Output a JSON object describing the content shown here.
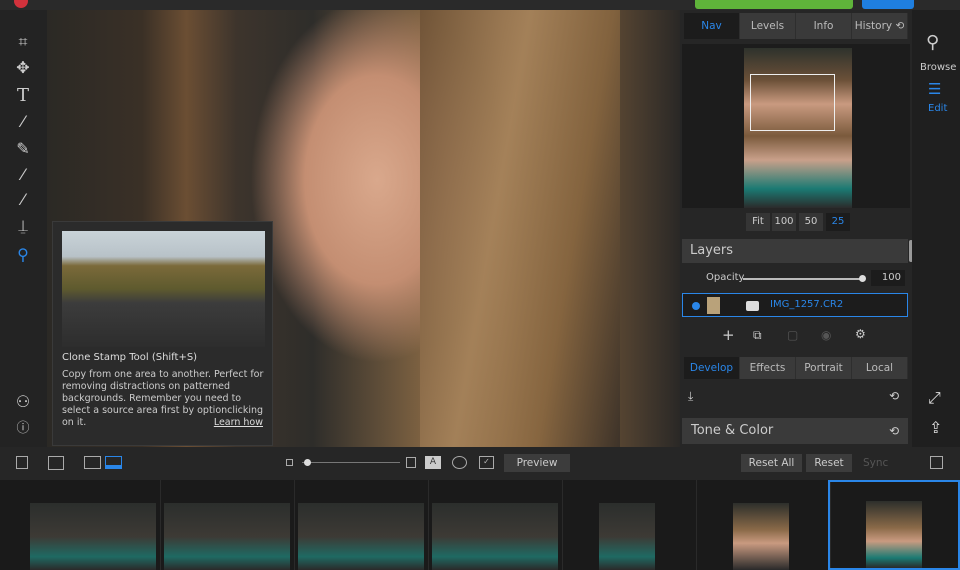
{
  "nav_tabs": [
    "Nav",
    "Levels",
    "Info",
    "History ⟲"
  ],
  "zoom_buttons": [
    "Fit",
    "100",
    "50",
    "25"
  ],
  "active_zoom": "25",
  "layers": {
    "title": "Layers",
    "opacity_label": "Opacity",
    "opacity_value": "100",
    "layer_name": "IMG_1257.CR2"
  },
  "module_tabs": [
    "Develop",
    "Effects",
    "Portrait",
    "Local"
  ],
  "section_title": "Tone & Color",
  "right_nav": {
    "browse": "Browse",
    "edit": "Edit"
  },
  "tooltip": {
    "title": "Clone Stamp Tool (Shift+S)",
    "text": "Copy from one area to another. Perfect for removing distractions on patterned backgrounds. Remember you need to select a source area first by optionclicking on it.",
    "link": "Learn how"
  },
  "bottom": {
    "preview": "Preview",
    "reset_all": "Reset All",
    "reset": "Reset",
    "sync": "Sync"
  },
  "colors": {
    "accent": "#2a86e8",
    "brand": "#d2323c"
  }
}
